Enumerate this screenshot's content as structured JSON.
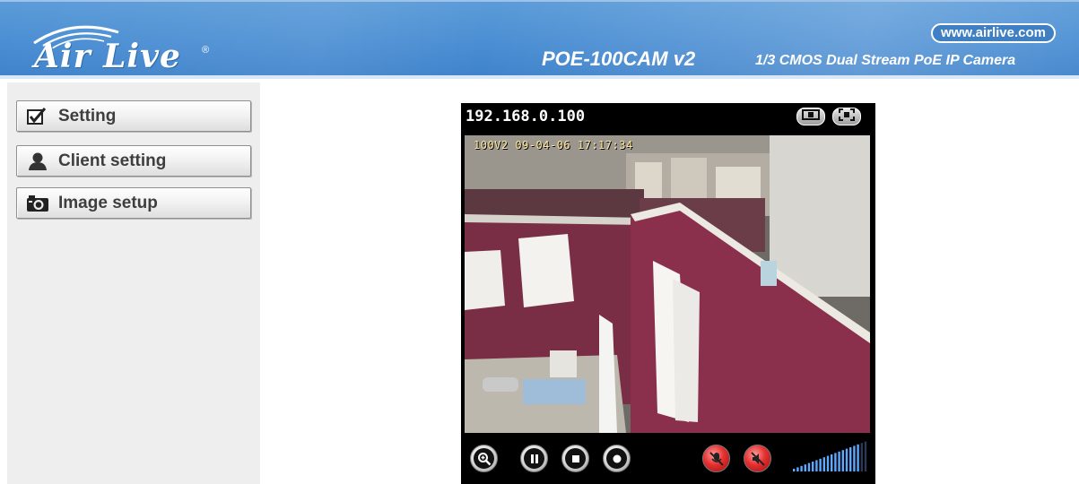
{
  "header": {
    "logo_text": "Air Live",
    "logo_mark": "®",
    "url_badge": "www.airlive.com",
    "model": "POE-100CAM v2",
    "tagline": "1/3 CMOS Dual Stream PoE IP Camera",
    "colors": {
      "banner": "#4b8ed3",
      "text": "#ffffff"
    }
  },
  "sidebar": {
    "items": [
      {
        "label": "Setting",
        "icon": "checkbox-icon"
      },
      {
        "label": "Client setting",
        "icon": "user-icon"
      },
      {
        "label": "Image setup",
        "icon": "camera-icon"
      }
    ]
  },
  "viewer": {
    "ip_address": "192.168.0.100",
    "osd_text": "100V2 09-04-06 17:17:34",
    "top_buttons": [
      "toggle-size-icon",
      "fullscreen-icon"
    ],
    "controls": [
      {
        "name": "zoom-button",
        "icon": "zoom-icon"
      },
      {
        "name": "pause-button",
        "icon": "pause-icon"
      },
      {
        "name": "stop-button",
        "icon": "stop-icon"
      },
      {
        "name": "record-button",
        "icon": "record-icon"
      },
      {
        "name": "mic-mute-button",
        "icon": "mic-off-icon"
      },
      {
        "name": "speaker-mute-button",
        "icon": "speaker-off-icon"
      }
    ],
    "volume_level": 0.9
  }
}
